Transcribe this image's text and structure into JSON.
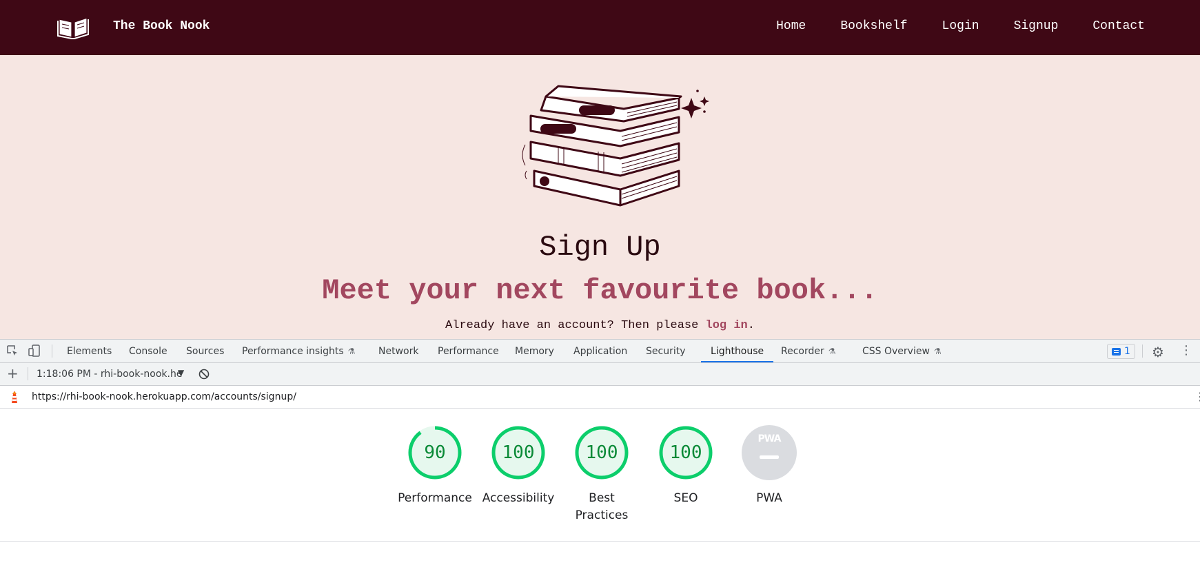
{
  "site": {
    "brand": "The Book Nook",
    "nav": [
      "Home",
      "Bookshelf",
      "Login",
      "Signup",
      "Contact"
    ],
    "colors": {
      "navbar": "#3f0815",
      "hero_bg": "#f6e6e2",
      "accent": "#a2475f"
    }
  },
  "hero": {
    "title": "Sign Up",
    "tagline": "Meet your next favourite book...",
    "note_prefix": "Already have an account? Then please",
    "note_link": "log in",
    "note_suffix": "."
  },
  "devtools": {
    "tabs": [
      {
        "label": "Elements"
      },
      {
        "label": "Console"
      },
      {
        "label": "Sources"
      },
      {
        "label": "Performance insights",
        "experimental": true
      },
      {
        "label": "Network"
      },
      {
        "label": "Performance"
      },
      {
        "label": "Memory"
      },
      {
        "label": "Application"
      },
      {
        "label": "Security"
      },
      {
        "label": "Lighthouse",
        "active": true
      },
      {
        "label": "Recorder",
        "experimental": true
      },
      {
        "label": "CSS Overview",
        "experimental": true
      }
    ],
    "issues_count": "1",
    "report_label": "1:18:06 PM - rhi-book-nook.he",
    "url": "https://rhi-book-nook.herokuapp.com/accounts/signup/",
    "scores": [
      {
        "label": "Performance",
        "value": "90",
        "fraction": 0.9
      },
      {
        "label": "Accessibility",
        "value": "100",
        "fraction": 1.0
      },
      {
        "label": "Best Practices",
        "value": "100",
        "fraction": 1.0
      },
      {
        "label": "SEO",
        "value": "100",
        "fraction": 1.0
      },
      {
        "label": "PWA",
        "value": "",
        "fraction": 0
      }
    ],
    "pwa_badge": "PWA",
    "colors": {
      "pass": "#0cce6b",
      "pass_text": "#0a8a37",
      "tab_active": "#1a73e8"
    }
  }
}
